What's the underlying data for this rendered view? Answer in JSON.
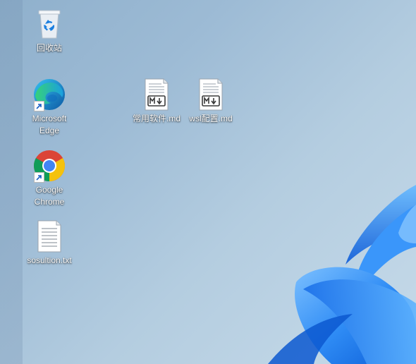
{
  "desktop": {
    "icons": [
      {
        "label": "回收站",
        "icon": "recycle-bin-icon"
      },
      {
        "label": "Microsoft Edge",
        "icon": "edge-icon"
      },
      {
        "label": "Google Chrome",
        "icon": "chrome-icon"
      },
      {
        "label": "sosultion.txt",
        "icon": "text-file-icon"
      },
      {
        "label": "常用软件.md",
        "icon": "markdown-file-icon"
      },
      {
        "label": "wsl配置.md",
        "icon": "markdown-file-icon"
      }
    ],
    "colors": {
      "wallpaper_top": "#8fb0cc",
      "wallpaper_bottom": "#c6dae9",
      "bloom_blue": "#1e78f0",
      "bloom_light": "#4fa8ff"
    }
  }
}
